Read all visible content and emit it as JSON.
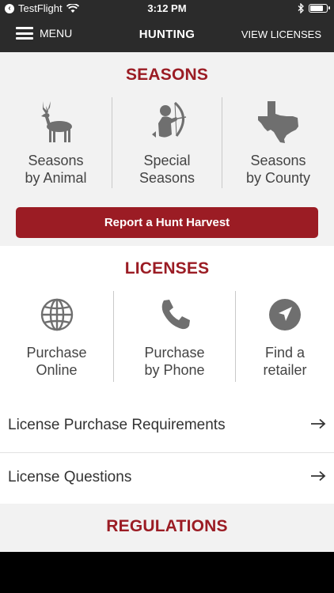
{
  "status_bar": {
    "back_app": "TestFlight",
    "time": "3:12 PM",
    "battery_level": 0.85
  },
  "nav": {
    "menu_label": "MENU",
    "title": "HUNTING",
    "view_licenses_label": "VIEW LICENSES"
  },
  "seasons": {
    "title": "SEASONS",
    "tiles": [
      {
        "line1": "Seasons",
        "line2": "by Animal",
        "icon": "deer-icon"
      },
      {
        "line1": "Special",
        "line2": "Seasons",
        "icon": "archer-icon"
      },
      {
        "line1": "Seasons",
        "line2": "by County",
        "icon": "texas-map-icon"
      }
    ],
    "report_button": "Report a Hunt Harvest"
  },
  "licenses": {
    "title": "LICENSES",
    "tiles": [
      {
        "line1": "Purchase",
        "line2": "Online",
        "icon": "globe-icon"
      },
      {
        "line1": "Purchase",
        "line2": "by Phone",
        "icon": "phone-icon"
      },
      {
        "line1": "Find a",
        "line2": "retailer",
        "icon": "location-arrow-icon"
      }
    ],
    "links": [
      {
        "label": "License Purchase Requirements"
      },
      {
        "label": "License Questions"
      }
    ]
  },
  "regulations": {
    "title": "REGULATIONS"
  },
  "colors": {
    "brand_red": "#9b1c24",
    "nav_dark": "#2b2b2b",
    "icon_gray": "#6f6f6f"
  }
}
